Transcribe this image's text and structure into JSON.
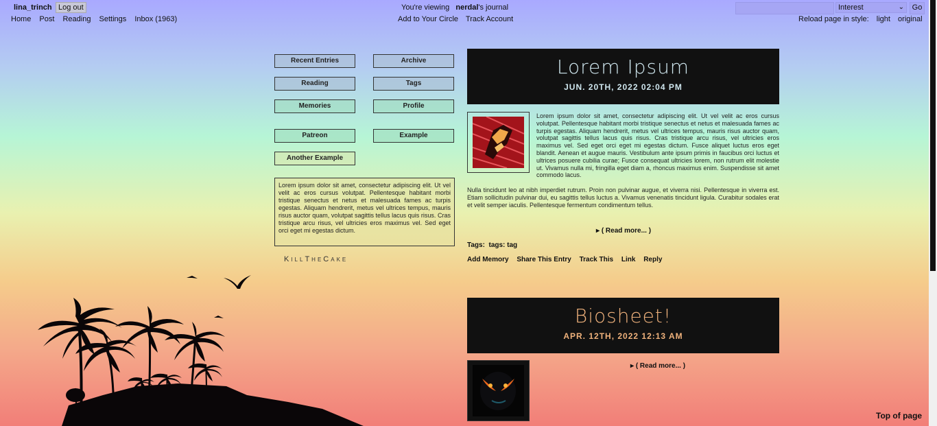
{
  "topbar": {
    "username": "lina_trinch",
    "logout": "Log out",
    "nav": [
      "Home",
      "Post",
      "Reading",
      "Settings",
      "Inbox (1963)"
    ],
    "viewing_prefix": "You're viewing",
    "viewing_user": "nerdal",
    "viewing_suffix": "'s journal",
    "circle_links": [
      "Add to Your Circle",
      "Track Account"
    ],
    "search_value": "",
    "search_select": "Interest",
    "go": "Go",
    "style_label": "Reload page in style:",
    "style_options": [
      "light",
      "original"
    ]
  },
  "sidebar": {
    "buttons": [
      "Recent Entries",
      "Archive",
      "Reading",
      "Tags",
      "Memories",
      "Profile",
      "Patreon",
      "Example",
      "Another Example"
    ],
    "box_text": "Lorem ipsum dolor sit amet, consectetur adipiscing elit. Ut vel velit ac eros cursus volutpat. Pellentesque habitant morbi tristique senectus et netus et malesuada fames ac turpis egestas. Aliquam hendrerit, metus vel ultrices tempus, mauris risus auctor quam, volutpat sagittis tellus lacus quis risus. Cras tristique arcu risus, vel ultricies eros maximus vel. Sed eget orci eget mi egestas dictum.",
    "credit": "KillTheCake"
  },
  "entries": [
    {
      "title": "Lorem Ipsum",
      "date": "JUN. 20TH, 2022 02:04 PM",
      "title_color": "#cfe6ee",
      "date_color": "#cfe6ee",
      "para1": "Lorem ipsum dolor sit amet, consectetur adipiscing elit. Ut vel velit ac eros cursus volutpat. Pellentesque habitant morbi tristique senectus et netus et malesuada fames ac turpis egestas. Aliquam hendrerit, metus vel ultrices tempus, mauris risus auctor quam, volutpat sagittis tellus lacus quis risus. Cras tristique arcu risus, vel ultricies eros maximus vel. Sed eget orci eget mi egestas dictum. Fusce aliquet luctus eros eget blandit. Aenean et augue mauris. Vestibulum ante ipsum primis in faucibus orci luctus et ultrices posuere cubilia curae; Fusce consequat ultricies lorem, non rutrum elit molestie ut. Vivamus nulla mi, fringilla eget diam a, rhoncus maximus enim. Suspendisse sit amet commodo lacus.",
      "para2": "Nulla tincidunt leo at nibh imperdiet rutrum. Proin non pulvinar augue, et viverra nisi. Pellentesque in viverra est. Etiam sollicitudin pulvinar dui, eu sagittis tellus luctus a. Vivamus venenatis tincidunt ligula. Curabitur sodales erat et velit semper iaculis. Pellentesque fermentum condimentum tellus.",
      "read_more": "( Read more... )",
      "tags_label": "Tags:",
      "tags": "tags: tag",
      "actions": [
        "Add Memory",
        "Share This Entry",
        "Track This",
        "Link",
        "Reply"
      ]
    },
    {
      "title": "Biosheet!",
      "date": "APR. 12TH, 2022 12:13 AM",
      "title_color": "#f0b27c",
      "date_color": "#f0b27c",
      "read_more": "( Read more... )"
    }
  ],
  "footer": {
    "top_of_page": "Top of page"
  }
}
